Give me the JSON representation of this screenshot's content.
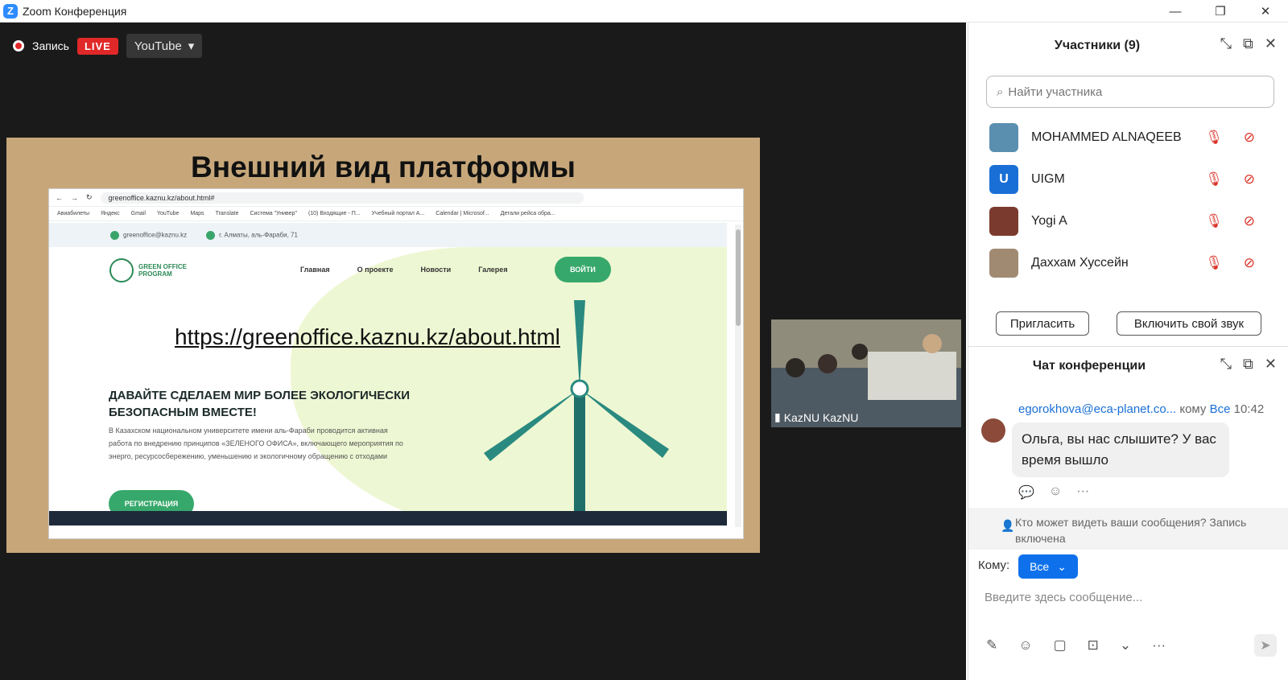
{
  "window": {
    "title": "Zoom Конференция",
    "minimize": "—",
    "restore": "❐",
    "close": "✕"
  },
  "record": {
    "label": "Запись",
    "live": "LIVE",
    "stream": "YouTube"
  },
  "slide": {
    "heading": "Внешний вид платформы",
    "browser_url": "greenoffice.kaznu.kz/about.html#",
    "bookmarks": [
      "Авиабилеты",
      "Яндекс",
      "Gmail",
      "YouTube",
      "Maps",
      "Translate",
      "Система \"Универ\"",
      "(10) Входящие - П...",
      "Учебный портал А...",
      "Calendar | Microsof...",
      "Детали рейса обра..."
    ],
    "email": "greenoffice@kaznu.kz",
    "address": "г. Алматы, аль-Фараби, 71",
    "logo": "GREEN OFFICE PROGRAM",
    "nav": [
      "Главная",
      "О проекте",
      "Новости",
      "Галерея"
    ],
    "login": "ВОЙТИ",
    "url_text": "https://greenoffice.kaznu.kz/about.html",
    "hero": "ДАВАЙТЕ СДЕЛАЕМ МИР БОЛЕЕ ЭКОЛОГИЧЕСКИ БЕЗОПАСНЫМ ВМЕСТЕ!",
    "hero_text": "В Казахском национальном университете имени аль-Фараби проводится активная работа по внедрению принципов «ЗЕЛЕНОГО ОФИСА», включающего мероприятия по энерго, ресурсосбережению, уменьшению и экологичному обращению с отходами",
    "register": "РЕГИСТРАЦИЯ"
  },
  "camera": {
    "name": "KazNU KazNU"
  },
  "participants": {
    "title": "Участники (9)",
    "search_placeholder": "Найти участника",
    "list": [
      {
        "name": "MOHAMMED ALNAQEEB",
        "avatar": ""
      },
      {
        "name": "UIGM",
        "avatar": "U"
      },
      {
        "name": "Yogi A",
        "avatar": ""
      },
      {
        "name": "Даххам Хуссейн",
        "avatar": ""
      }
    ],
    "invite": "Пригласить",
    "unmute": "Включить свой звук"
  },
  "chat": {
    "title": "Чат конференции",
    "sender": "egorokhova@eca-planet.co...",
    "to": "кому",
    "to_target": "Все",
    "time": "10:42",
    "message": "Ольга, вы нас слышите? У вас время вышло",
    "visibility": "Кто может видеть ваши сообщения? Запись включена",
    "to_label": "Кому:",
    "to_value": "Все",
    "input_placeholder": "Введите здесь сообщение..."
  },
  "colors": {
    "live": "#e02828",
    "accent": "#0e71eb",
    "muted": "#d93025",
    "green": "#37a86b"
  }
}
